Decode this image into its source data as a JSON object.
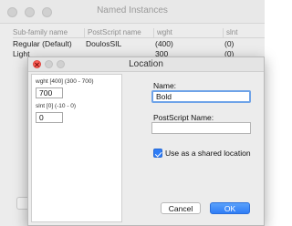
{
  "background_window": {
    "title": "Named Instances",
    "columns": [
      "Sub-family name",
      "PostScript name",
      "wght",
      "slnt"
    ],
    "rows": [
      [
        "Regular (Default)",
        "DoulosSIL",
        "(400)",
        "(0)"
      ],
      [
        "Light",
        "",
        "300",
        "(0)"
      ]
    ]
  },
  "dialog": {
    "title": "Location",
    "axes": [
      {
        "label": "wght [400]  (300 - 700)",
        "value": "700"
      },
      {
        "label": "slnt [0]  (-10 - 0)",
        "value": "0"
      }
    ],
    "name_label": "Name:",
    "name_value": "Bold",
    "postscript_label": "PostScript  Name:",
    "postscript_value": "",
    "shared_checkbox_label": "Use as a shared location",
    "shared_checked": true,
    "cancel_label": "Cancel",
    "ok_label": "OK"
  },
  "colors": {
    "accent": "#2f7df6",
    "focus_ring": "#6ea3e8",
    "close_red": "#fc5f57"
  }
}
